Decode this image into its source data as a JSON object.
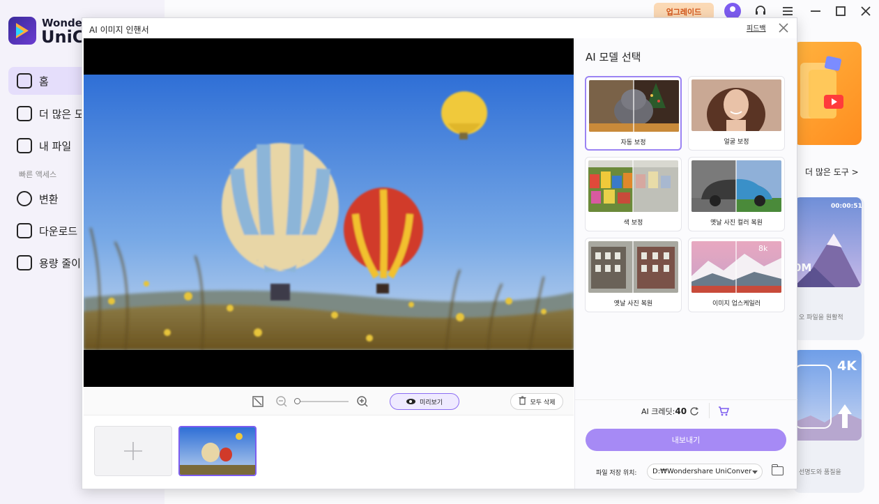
{
  "app": {
    "logo_line1": "Wonders",
    "logo_line2": "UniCo",
    "nav": [
      {
        "label": "홈",
        "icon": "home-icon",
        "active": true
      },
      {
        "label": "더 많은 도",
        "icon": "toolbox-icon"
      },
      {
        "label": "내 파일",
        "icon": "file-icon"
      }
    ],
    "quick_access_label": "빠른 액세스",
    "quick": [
      {
        "label": "변환",
        "icon": "convert-icon"
      },
      {
        "label": "다운로드",
        "icon": "download-icon"
      },
      {
        "label": "용량 줄이",
        "icon": "compress-icon"
      }
    ],
    "topbar": {
      "upgrade_label": "업그레이드"
    },
    "right": {
      "more_tools": "더 많은 도구 >",
      "card1_time": "00:00:51",
      "card1_badge": "0M",
      "card1_note": "오 파일을 원활적",
      "card2_badge": "4K",
      "card2_note": "선명도와 품질을"
    }
  },
  "dialog": {
    "title": "AI 이미지 인핸서",
    "feedback_link": "피드백",
    "toolbar": {
      "preview_label": "미리보기",
      "delete_all_label": "모두 삭제"
    },
    "right_panel": {
      "title": "AI 모델 선택",
      "models": [
        {
          "label": "자동 보정",
          "selected": true,
          "kind": "cat"
        },
        {
          "label": "얼굴 보정",
          "kind": "face"
        },
        {
          "label": "색 보정",
          "kind": "houses"
        },
        {
          "label": "옛날 사진 컬러 복원",
          "kind": "car"
        },
        {
          "label": "옛날 사진 복원",
          "kind": "street"
        },
        {
          "label": "이미지 업스케일러",
          "kind": "mountain",
          "badge": "8k"
        }
      ],
      "credits_label": "AI 크레딧:",
      "credits_value": "40",
      "export_label": "내보내기",
      "save_location_label": "파일 저장 위치:",
      "save_path": "D:₩Wondershare UniConver"
    }
  },
  "colors": {
    "accent": "#8b6cf3",
    "export_btn": "#a68af5",
    "upgrade_bg": "#fbd9b5",
    "upgrade_text": "#d4561a"
  }
}
